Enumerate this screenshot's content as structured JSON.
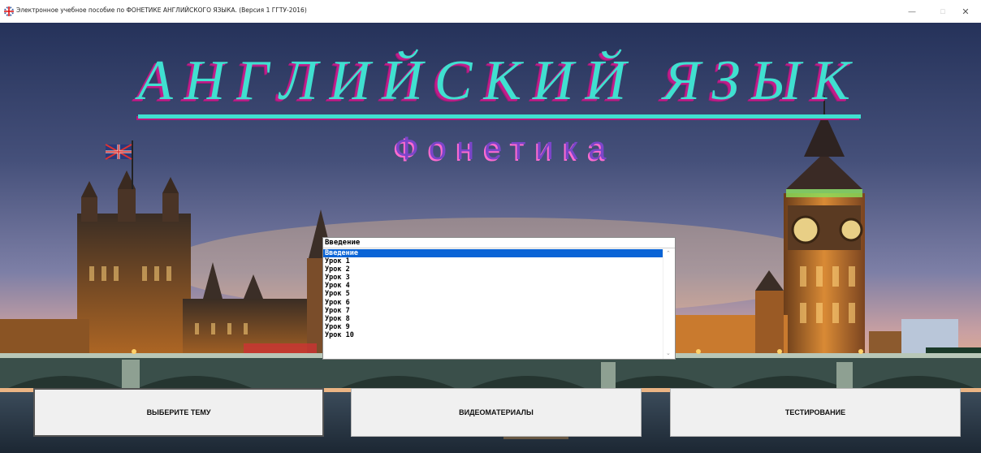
{
  "window": {
    "title": "Электронное учебное пособие по ФОНЕТИКЕ АНГЛИЙСКОГО ЯЗЫКА. (Версия 1   ГГТУ-2016)",
    "icon": "uk-flag-icon",
    "controls": {
      "minimize": "—",
      "maximize": "□",
      "close": "✕"
    }
  },
  "header": {
    "title": "АНГЛИЙСКИЙ ЯЗЫК",
    "subtitle": "Фонетика"
  },
  "topic_combo": {
    "value": "Введение",
    "items": [
      "Введение",
      "Урок 1",
      "Урок 2",
      "Урок 3",
      "Урок 4",
      "Урок 5",
      "Урок 6",
      "Урок 7",
      "Урок 8",
      "Урок 9",
      "Урок 10"
    ],
    "selected_index": 0
  },
  "buttons": {
    "choose_topic": "ВЫБЕРИТЕ ТЕМУ",
    "video": "ВИДЕОМАТЕРИАЛЫ",
    "testing": "ТЕСТИРОВАНИЕ"
  },
  "colors": {
    "heading": "#40e0d0",
    "heading_shadow": "#c21c8a",
    "subheading": "#7b45c9",
    "selection": "#0a64d6"
  }
}
